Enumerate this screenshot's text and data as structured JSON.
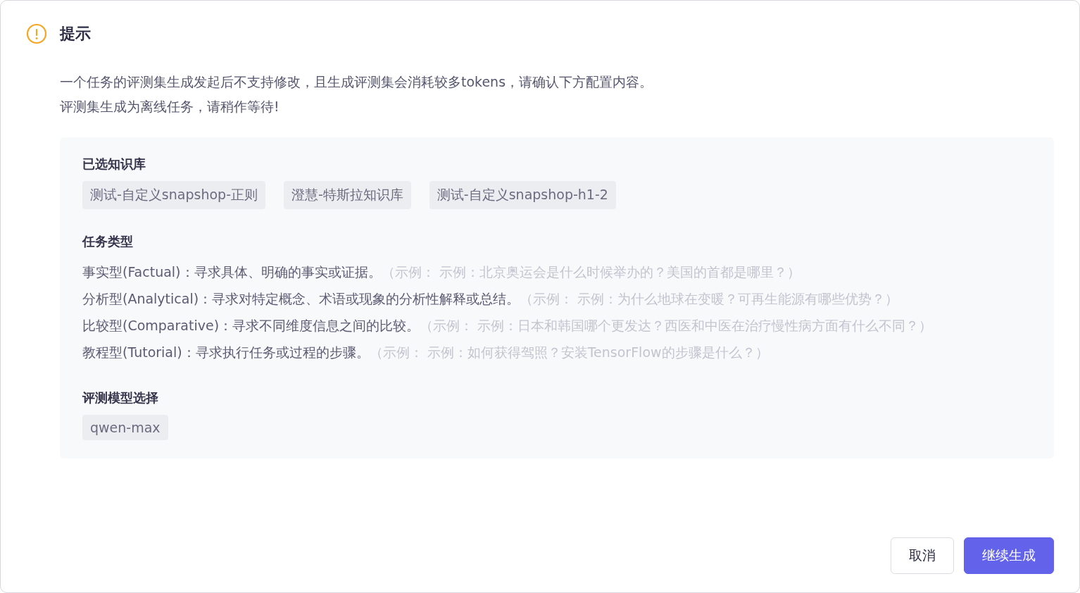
{
  "dialog": {
    "title": "提示",
    "message_lines": [
      "一个任务的评测集生成发起后不支持修改，且生成评测集会消耗较多tokens，请确认下方配置内容。",
      "评测集生成为离线任务，请稍作等待!"
    ],
    "knowledge_bases": {
      "label": "已选知识库",
      "tags": [
        "测试-自定义snapshop-正则",
        "澄慧-特斯拉知识库",
        "测试-自定义snapshop-h1-2"
      ]
    },
    "task_types": {
      "label": "任务类型",
      "items": [
        {
          "description": "事实型(Factual)：寻求具体、明确的事实或证据。",
          "example": "（示例： 示例：北京奥运会是什么时候举办的？美国的首都是哪里？）"
        },
        {
          "description": "分析型(Analytical)：寻求对特定概念、术语或现象的分析性解释或总结。",
          "example": "（示例： 示例：为什么地球在变暖？可再生能源有哪些优势？）"
        },
        {
          "description": "比较型(Comparative)：寻求不同维度信息之间的比较。",
          "example": "（示例： 示例：日本和韩国哪个更发达？西医和中医在治疗慢性病方面有什么不同？）"
        },
        {
          "description": "教程型(Tutorial)：寻求执行任务或过程的步骤。",
          "example": "（示例： 示例：如何获得驾照？安装TensorFlow的步骤是什么？）"
        }
      ]
    },
    "model": {
      "label": "评测模型选择",
      "tags": [
        "qwen-max"
      ]
    },
    "buttons": [
      {
        "label": "取消",
        "kind": "secondary"
      },
      {
        "label": "继续生成",
        "kind": "primary"
      }
    ]
  }
}
